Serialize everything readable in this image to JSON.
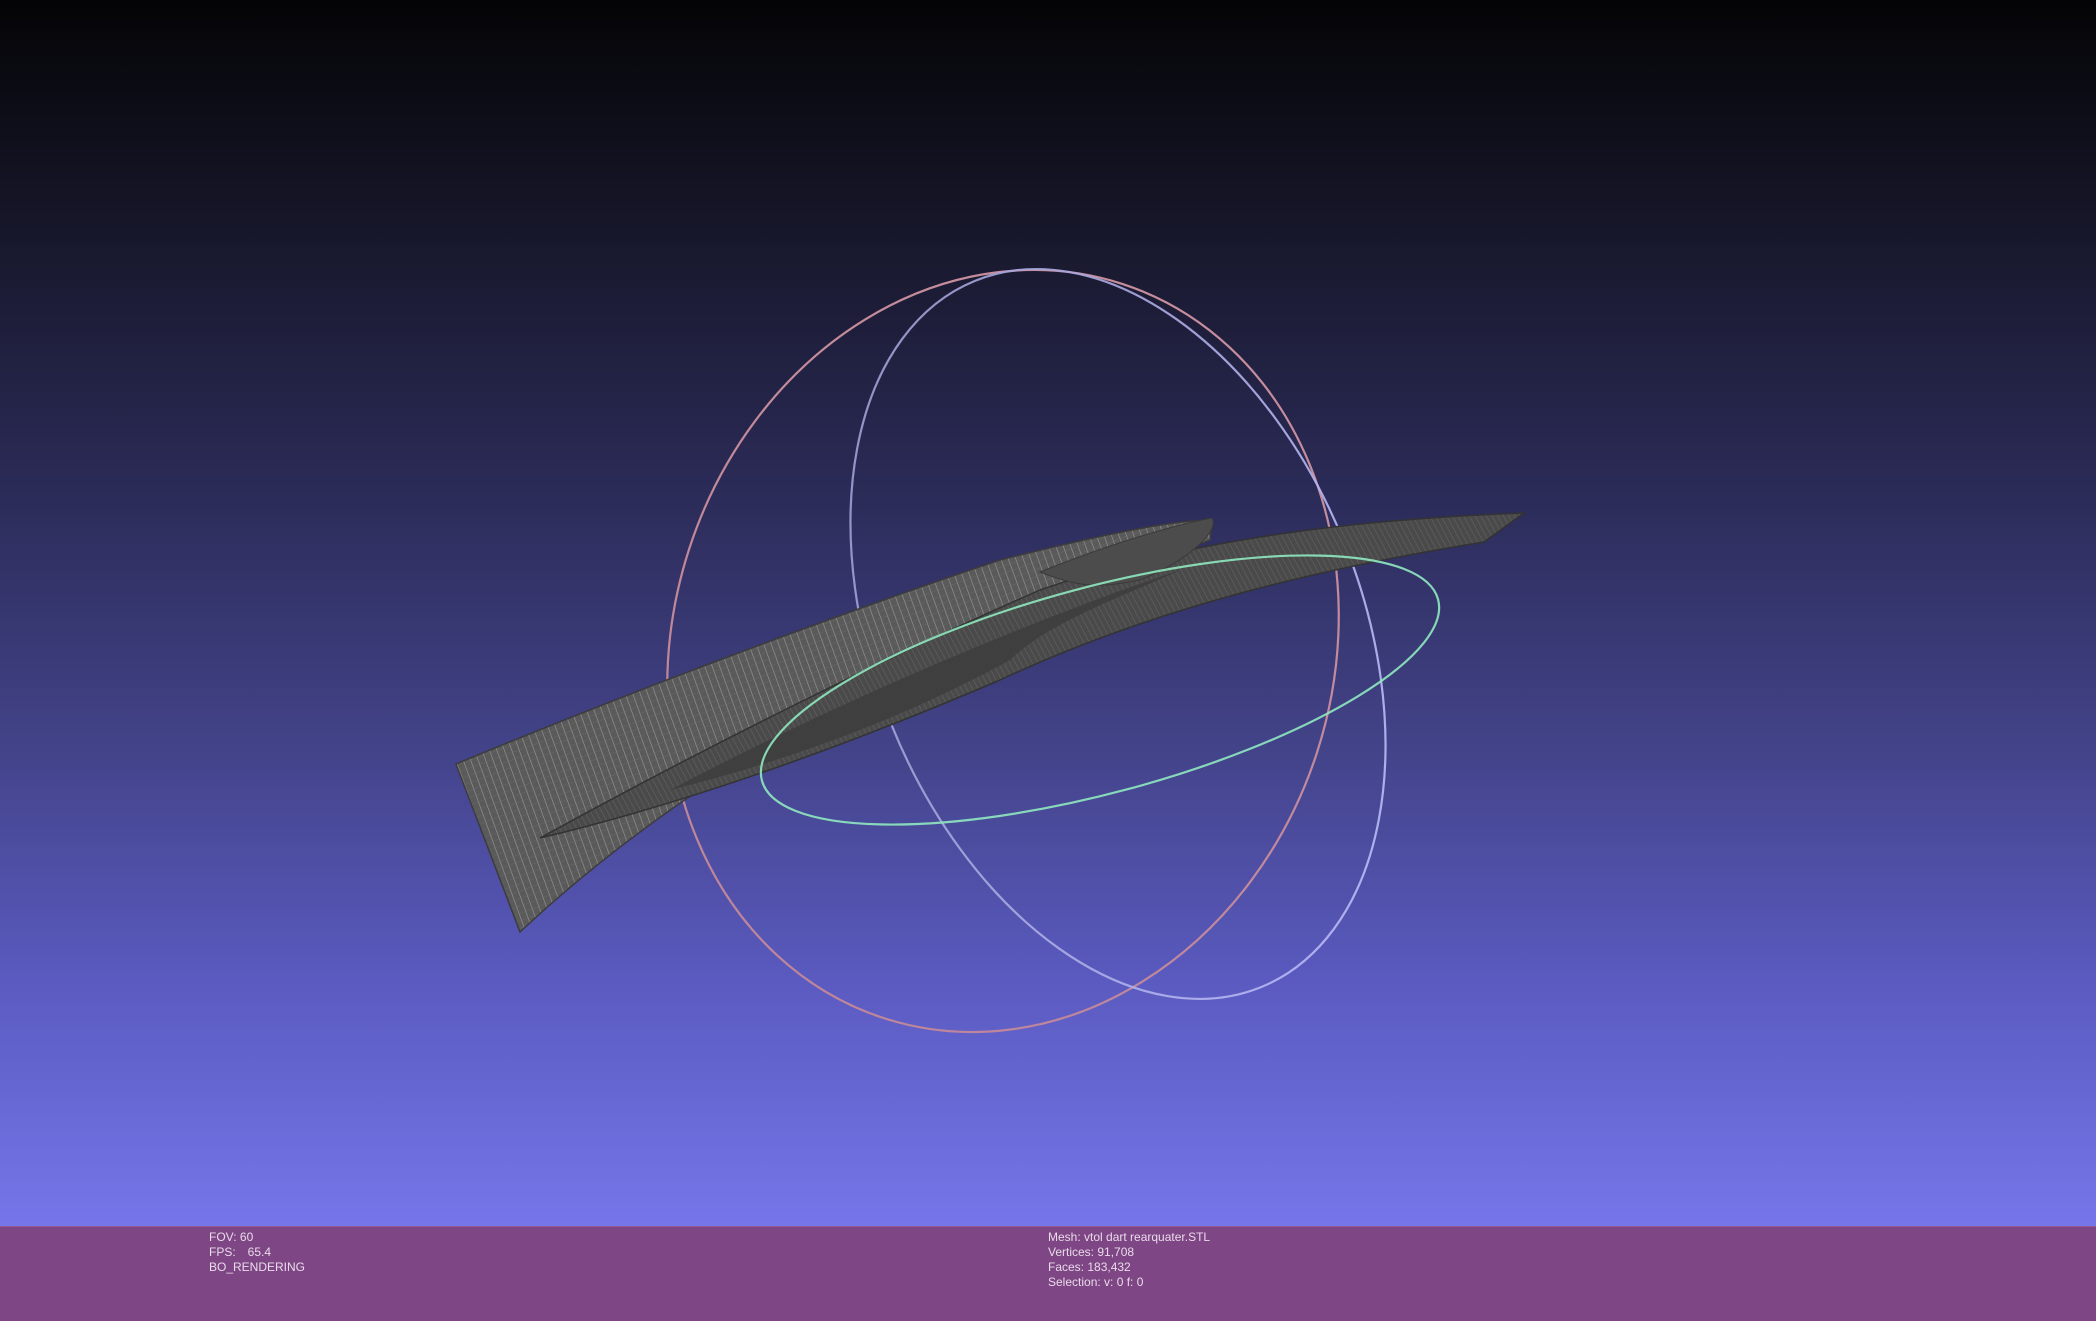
{
  "render_info": {
    "fov": "FOV: 60",
    "fps_label": "FPS:",
    "fps_value": "65.4",
    "mode": "BO_RENDERING"
  },
  "mesh_info": {
    "mesh": "Mesh: vtol dart rearquater.STL",
    "vertices": "Vertices: 91,708",
    "faces": "Faces: 183,432",
    "selection": "Selection: v: 0 f: 0"
  },
  "colors": {
    "background_top": "#040406",
    "background_bottom": "#7676ea",
    "info_bar": "#7e4684",
    "mesh": "#505050",
    "trackball_x": "#e8a0a8",
    "trackball_y": "#b8b8ff",
    "trackball_z": "#8fe8c0"
  },
  "icons": {
    "trackball": "trackball-gizmo",
    "mesh": "wireframe-mesh"
  }
}
